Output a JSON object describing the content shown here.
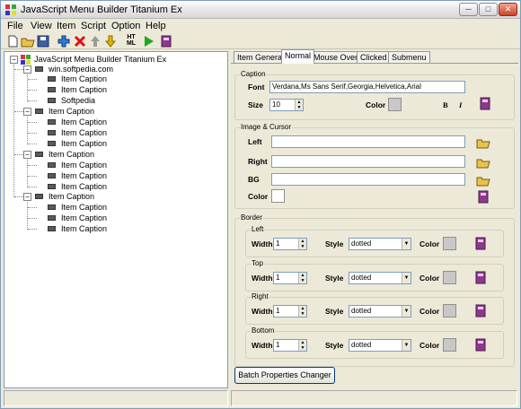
{
  "window": {
    "title": "JavaScript Menu Builder Titanium Ex"
  },
  "menubar": {
    "items": [
      "File",
      "View",
      "Item",
      "Script",
      "Option",
      "Help"
    ]
  },
  "toolbar": {
    "html_label_top": "HT",
    "html_label_bottom": "ML"
  },
  "tree": {
    "root": "JavaScript Menu Builder Titanium Ex",
    "groups": [
      {
        "label": "win.softpedia.com",
        "children": [
          "Item Caption",
          "Item Caption",
          "Softpedia"
        ]
      },
      {
        "label": "Item Caption",
        "children": [
          "Item Caption",
          "Item Caption",
          "Item Caption"
        ]
      },
      {
        "label": "Item Caption",
        "children": [
          "Item Caption",
          "Item Caption",
          "Item Caption"
        ]
      },
      {
        "label": "Item Caption",
        "children": [
          "Item Caption",
          "Item Caption",
          "Item Caption"
        ]
      }
    ],
    "expander_minus": "−"
  },
  "tabs": [
    {
      "label": "Item General",
      "active": false
    },
    {
      "label": "Normal",
      "active": true
    },
    {
      "label": "Mouse Over",
      "active": false
    },
    {
      "label": "Clicked",
      "active": false
    },
    {
      "label": "Submenu",
      "active": false
    }
  ],
  "caption": {
    "group_label": "Caption",
    "font_label": "Font",
    "font_value": "Verdana,Ms Sans Serif,Georgia,Helvetica,Arial",
    "size_label": "Size",
    "size_value": "10",
    "color_label": "Color",
    "bold_label": "B",
    "italic_label": "I"
  },
  "image_cursor": {
    "group_label": "Image & Cursor",
    "left_label": "Left",
    "right_label": "Right",
    "bg_label": "BG",
    "color_label": "Color",
    "left_value": "",
    "right_value": "",
    "bg_value": ""
  },
  "border": {
    "group_label": "Border",
    "width_label": "Width",
    "style_label": "Style",
    "color_label": "Color",
    "sides": [
      {
        "label": "Left",
        "width": "1",
        "style": "dotted"
      },
      {
        "label": "Top",
        "width": "1",
        "style": "dotted"
      },
      {
        "label": "Right",
        "width": "1",
        "style": "dotted"
      },
      {
        "label": "Bottom",
        "width": "1",
        "style": "dotted"
      }
    ]
  },
  "batch_button": "Batch Properties Changer",
  "colors": {
    "accent": "#3a6ea5",
    "swatch_gray": "#c8c8c8",
    "book_purple": "#8b3a8b"
  }
}
